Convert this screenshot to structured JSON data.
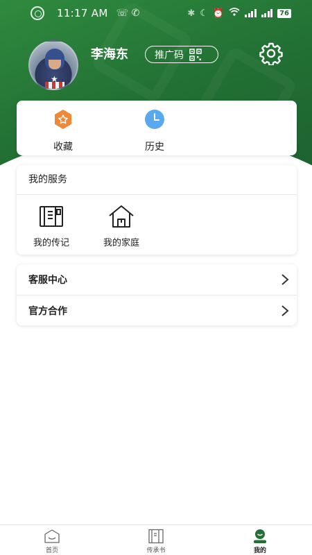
{
  "status_bar": {
    "time": "11:17 AM",
    "network": "☎ ✉",
    "battery": "76"
  },
  "profile": {
    "name": "李海东",
    "promo_label": "推广码"
  },
  "quick_actions": [
    {
      "label": "收藏",
      "icon": "favorites-star-icon",
      "color": "#f0883a"
    },
    {
      "label": "历史",
      "icon": "history-clock-icon",
      "color": "#5aa9ee"
    }
  ],
  "services": {
    "title": "我的服务",
    "items": [
      {
        "label": "我的传记",
        "icon": "biography-book-icon"
      },
      {
        "label": "我的家庭",
        "icon": "family-house-icon"
      }
    ]
  },
  "menu": [
    {
      "label": "客服中心"
    },
    {
      "label": "官方合作"
    }
  ],
  "tab_bar": [
    {
      "label": "首页",
      "icon": "home-icon",
      "active": false
    },
    {
      "label": "传承书",
      "icon": "book-icon",
      "active": false
    },
    {
      "label": "我的",
      "icon": "profile-icon",
      "active": true
    }
  ],
  "colors": {
    "brand_green": "#227034",
    "orange": "#f0883a",
    "blue": "#5aa9ee"
  }
}
